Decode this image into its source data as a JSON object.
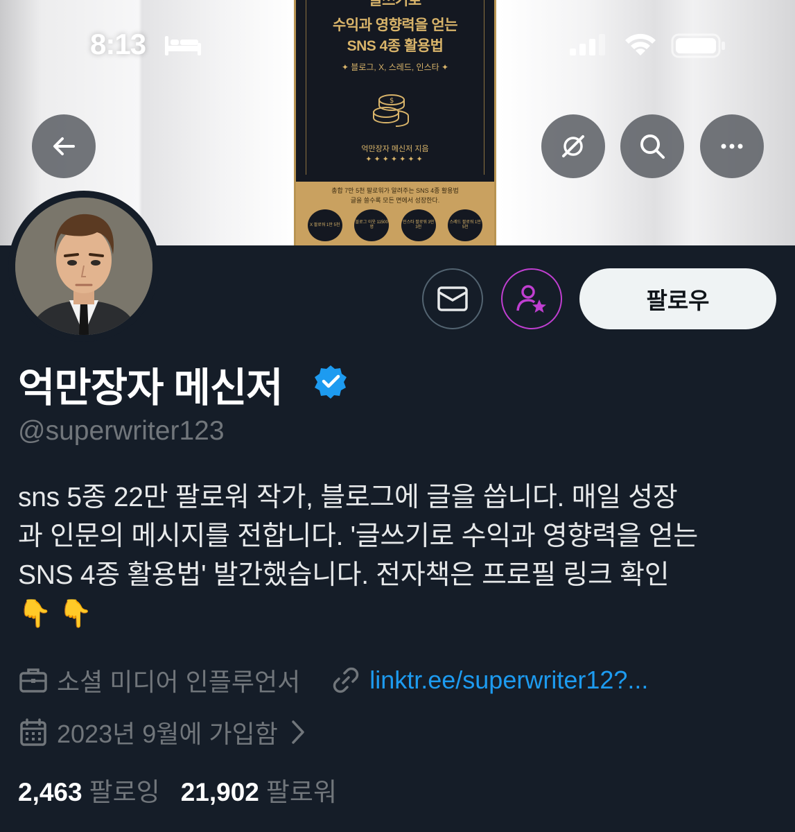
{
  "status_bar": {
    "time": "8:13",
    "icons": [
      "bed-icon",
      "cellular-signal-icon",
      "wifi-icon",
      "battery-icon"
    ]
  },
  "banner": {
    "book": {
      "title_line0": "글쓰기로",
      "title_line1": "수익과 영향력을 얻는",
      "title_line2": "SNS 4종 활용법",
      "subtitle": "✦ 블로그, X, 스레드, 인스타 ✦",
      "author": "억만장자 메신저 지음",
      "stars": "✦✦✦✦✦✦✦",
      "tagline1": "총합 7만 5천 팔로워가 알려주는 SNS 4종 활용법",
      "tagline2": "글을 쓸수록 모든 면에서 성장한다.",
      "badges": [
        "X 팔로워 1만 5천",
        "블로그 이웃 11500명",
        "인스타 팔로워 3만 3천",
        "스레드 팔로워 1만 5천"
      ]
    }
  },
  "nav": {
    "back_icon": "arrow-left-icon",
    "right_icons": [
      "grok-icon",
      "search-icon",
      "more-icon"
    ]
  },
  "actions": {
    "message_icon": "mail-icon",
    "subscribe_icon": "person-star-icon",
    "follow_label": "팔로우"
  },
  "profile": {
    "display_name": "억만장자 메신저",
    "verified": true,
    "handle": "@superwriter123",
    "bio_line1": "sns 5종 22만 팔로워 작가, 블로그에 글을 씁니다. 매일 성장",
    "bio_line2": "과 인문의 메시지를 전합니다. '글쓰기로 수익과 영향력을 얻는",
    "bio_line3": "SNS 4종 활용법' 발간했습니다. 전자책은 프로필 링크 확인",
    "bio_line4": "👇 👇",
    "category": "소셜 미디어 인플루언서",
    "link": "linktr.ee/superwriter12?...",
    "joined": "2023년 9월에 가입함",
    "following_count": "2,463",
    "following_label": "팔로잉",
    "followers_count": "21,902",
    "followers_label": "팔로워"
  },
  "colors": {
    "background": "#151d28",
    "link": "#1d9bf0",
    "verified": "#1d9bf0",
    "secondary_text": "#71767b",
    "subscribe_accent": "#c03fd1",
    "book_gold": "#d9b46a"
  }
}
